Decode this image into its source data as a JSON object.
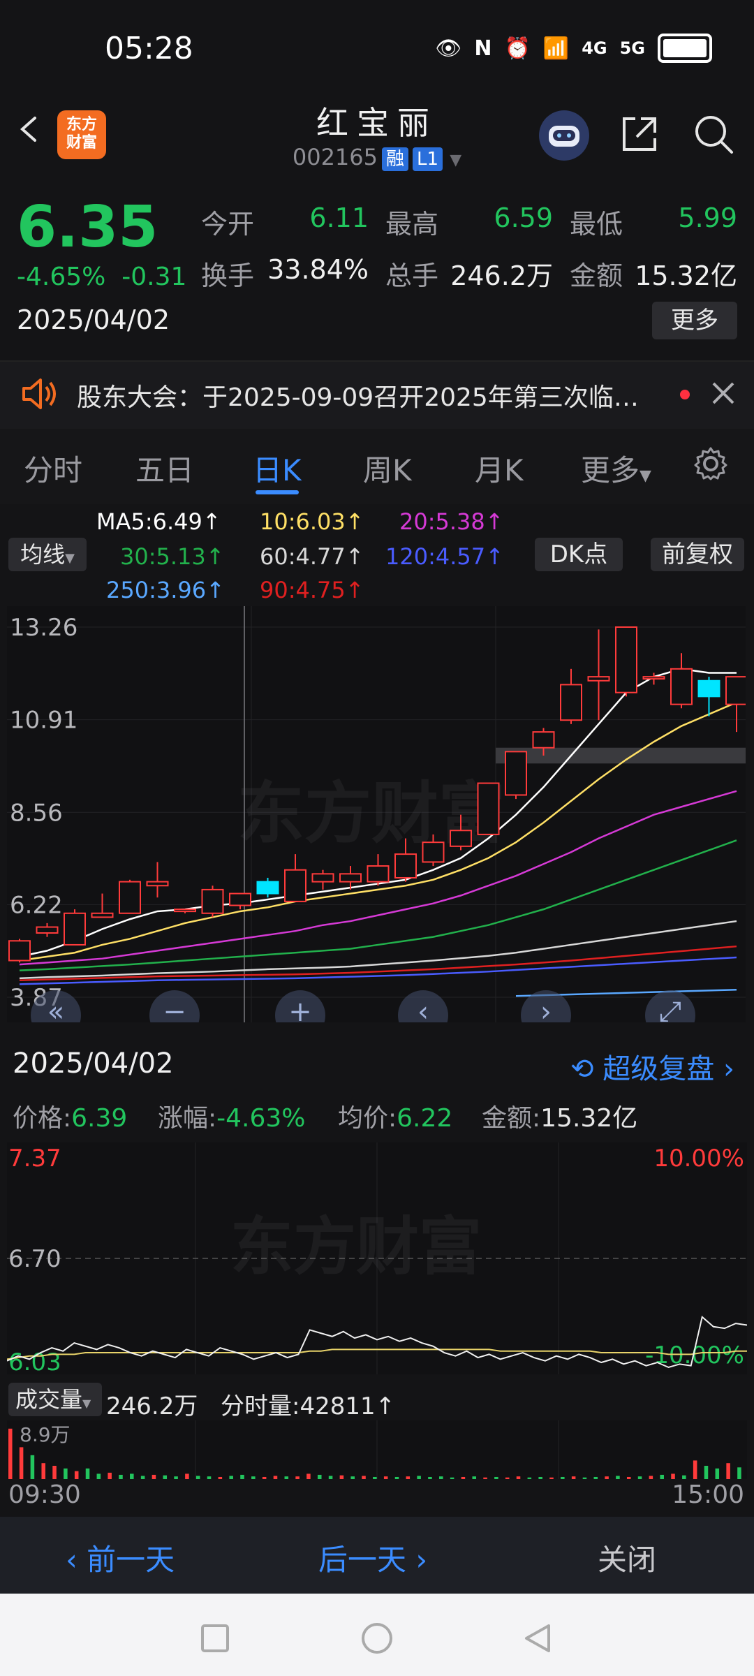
{
  "status_bar": {
    "time": "05:28",
    "network": "4G",
    "network2": "5G"
  },
  "header": {
    "logo_text_top": "东方",
    "logo_text_bottom": "财富",
    "stock_name": "红宝丽",
    "stock_code": "002165",
    "tag_margin": "融",
    "tag_level": "L1"
  },
  "quote": {
    "price": "6.35",
    "change_pct": "-4.65%",
    "change_amt": "-0.31",
    "date": "2025/04/02",
    "open_label": "今开",
    "open": "6.11",
    "high_label": "最高",
    "high": "6.59",
    "low_label": "最低",
    "low": "5.99",
    "turnover_label": "换手",
    "turnover": "33.84%",
    "volume_label": "总手",
    "volume": "246.2万",
    "amount_label": "金额",
    "amount": "15.32亿",
    "more_label": "更多"
  },
  "notice": {
    "text": "股东大会：于2025-09-09召开2025年第三次临…"
  },
  "tabs": [
    {
      "label": "分时"
    },
    {
      "label": "五日"
    },
    {
      "label": "日K"
    },
    {
      "label": "周K"
    },
    {
      "label": "月K"
    },
    {
      "label": "更多"
    }
  ],
  "ma_legend": {
    "dropdown": "均线",
    "ma5": "MA5:6.49↑",
    "ma10": "10:6.03↑",
    "ma20": "20:5.38↑",
    "ma30": "30:5.13↑",
    "ma60": "60:4.77↑",
    "ma120": "120:4.57↑",
    "ma250": "250:3.96↑",
    "ma90": "90:4.75↑",
    "dk_button": "DK点",
    "adjust_button": "前复权",
    "colors": {
      "ma5": "#ffffff",
      "ma10": "#ffe066",
      "ma20": "#d63ad6",
      "ma30": "#22b14c",
      "ma60": "#d8d8d8",
      "ma120": "#4a5cff",
      "ma250": "#5aa8ff",
      "ma90": "#e02020"
    }
  },
  "kchart": {
    "watermark": "东方财富",
    "axis_labels": [
      "13.26",
      "10.91",
      "8.56",
      "6.22",
      "3.87"
    ]
  },
  "chart_data": {
    "type": "candlestick",
    "ylim": [
      3.87,
      13.26
    ],
    "candles": [
      {
        "o": 4.8,
        "c": 5.3,
        "h": 5.35,
        "l": 4.75
      },
      {
        "o": 5.5,
        "c": 5.65,
        "h": 5.75,
        "l": 5.4
      },
      {
        "o": 5.2,
        "c": 6.0,
        "h": 6.1,
        "l": 5.2
      },
      {
        "o": 5.9,
        "c": 6.0,
        "h": 6.5,
        "l": 5.9
      },
      {
        "o": 6.0,
        "c": 6.8,
        "h": 6.85,
        "l": 6.0
      },
      {
        "o": 6.7,
        "c": 6.8,
        "h": 7.3,
        "l": 6.4
      },
      {
        "o": 6.1,
        "c": 6.1,
        "h": 6.1,
        "l": 6.0
      },
      {
        "o": 6.0,
        "c": 6.6,
        "h": 6.7,
        "l": 5.9
      },
      {
        "o": 6.2,
        "c": 6.5,
        "h": 6.5,
        "l": 6.1
      },
      {
        "o": 6.8,
        "c": 6.5,
        "h": 6.9,
        "l": 6.4
      },
      {
        "o": 6.3,
        "c": 7.1,
        "h": 7.5,
        "l": 6.3
      },
      {
        "o": 6.8,
        "c": 7.0,
        "h": 7.1,
        "l": 6.6
      },
      {
        "o": 6.8,
        "c": 7.0,
        "h": 7.2,
        "l": 6.6
      },
      {
        "o": 6.8,
        "c": 7.2,
        "h": 7.5,
        "l": 6.7
      },
      {
        "o": 6.9,
        "c": 7.5,
        "h": 7.9,
        "l": 6.8
      },
      {
        "o": 7.3,
        "c": 7.8,
        "h": 8.0,
        "l": 7.2
      },
      {
        "o": 7.7,
        "c": 8.1,
        "h": 8.5,
        "l": 7.6
      },
      {
        "o": 8.0,
        "c": 9.3,
        "h": 9.3,
        "l": 8.0
      },
      {
        "o": 9.0,
        "c": 10.1,
        "h": 10.1,
        "l": 8.9
      },
      {
        "o": 10.2,
        "c": 10.6,
        "h": 10.7,
        "l": 10.0
      },
      {
        "o": 10.9,
        "c": 11.8,
        "h": 12.2,
        "l": 10.8
      },
      {
        "o": 11.9,
        "c": 12.0,
        "h": 13.2,
        "l": 10.9
      },
      {
        "o": 11.6,
        "c": 13.26,
        "h": 13.26,
        "l": 11.5
      },
      {
        "o": 12.0,
        "c": 12.0,
        "h": 12.1,
        "l": 11.8
      },
      {
        "o": 11.3,
        "c": 12.2,
        "h": 12.6,
        "l": 11.2
      },
      {
        "o": 11.9,
        "c": 11.5,
        "h": 12.0,
        "l": 11.0
      },
      {
        "o": 11.3,
        "c": 12.0,
        "h": 12.0,
        "l": 10.6
      }
    ],
    "ma5": [
      4.9,
      5.05,
      5.3,
      5.6,
      5.85,
      6.05,
      6.1,
      6.2,
      6.25,
      6.35,
      6.45,
      6.55,
      6.65,
      6.75,
      6.85,
      7.1,
      7.4,
      7.9,
      8.5,
      9.2,
      10.0,
      10.8,
      11.6,
      12.0,
      12.2,
      12.1,
      12.1
    ],
    "ma10": [
      4.8,
      4.9,
      5.0,
      5.2,
      5.35,
      5.55,
      5.75,
      5.9,
      6.05,
      6.15,
      6.3,
      6.4,
      6.5,
      6.6,
      6.7,
      6.85,
      7.1,
      7.4,
      7.8,
      8.3,
      8.85,
      9.4,
      9.9,
      10.35,
      10.75,
      11.05,
      11.35
    ],
    "ma20": [
      4.7,
      4.75,
      4.8,
      4.85,
      4.95,
      5.05,
      5.15,
      5.25,
      5.35,
      5.45,
      5.55,
      5.7,
      5.8,
      5.95,
      6.1,
      6.25,
      6.45,
      6.7,
      6.95,
      7.25,
      7.55,
      7.9,
      8.2,
      8.5,
      8.7,
      8.9,
      9.1
    ],
    "ma30": [
      4.55,
      4.58,
      4.62,
      4.66,
      4.7,
      4.75,
      4.8,
      4.85,
      4.9,
      4.95,
      5.0,
      5.05,
      5.1,
      5.2,
      5.3,
      5.4,
      5.55,
      5.7,
      5.9,
      6.1,
      6.35,
      6.6,
      6.85,
      7.1,
      7.35,
      7.6,
      7.85
    ],
    "ma60": [
      4.35,
      4.38,
      4.4,
      4.42,
      4.45,
      4.48,
      4.5,
      4.52,
      4.55,
      4.58,
      4.6,
      4.62,
      4.65,
      4.7,
      4.75,
      4.8,
      4.86,
      4.92,
      5.0,
      5.1,
      5.2,
      5.3,
      5.4,
      5.5,
      5.6,
      5.7,
      5.8
    ],
    "ma90": [
      4.3,
      4.32,
      4.34,
      4.36,
      4.38,
      4.4,
      4.41,
      4.42,
      4.43,
      4.44,
      4.45,
      4.47,
      4.49,
      4.52,
      4.55,
      4.58,
      4.62,
      4.66,
      4.7,
      4.75,
      4.8,
      4.86,
      4.92,
      4.98,
      5.04,
      5.1,
      5.16
    ],
    "ma120": [
      4.2,
      4.22,
      4.24,
      4.26,
      4.28,
      4.3,
      4.31,
      4.32,
      4.33,
      4.34,
      4.35,
      4.37,
      4.39,
      4.41,
      4.43,
      4.46,
      4.49,
      4.52,
      4.56,
      4.6,
      4.64,
      4.68,
      4.72,
      4.76,
      4.8,
      4.84,
      4.88
    ],
    "ma250": [
      null,
      null,
      null,
      null,
      null,
      null,
      null,
      null,
      null,
      null,
      null,
      null,
      null,
      null,
      null,
      null,
      null,
      null,
      3.9,
      3.92,
      3.94,
      3.96,
      3.98,
      4.0,
      4.02,
      4.04,
      4.06
    ],
    "highlight_band": [
      9.8,
      10.2
    ]
  },
  "intraday_info": {
    "date": "2025/04/02",
    "super_replay": "超级复盘",
    "price_label": "价格:",
    "price": "6.39",
    "chg_label": "涨幅:",
    "chg": "-4.63%",
    "avg_label": "均价:",
    "avg": "6.22",
    "amt_label": "金额:",
    "amt": "15.32亿"
  },
  "minute_chart": {
    "y_top": "7.37",
    "y_mid": "6.70",
    "y_bot": "6.03",
    "pct_top": "10.00%",
    "pct_bot": "-10.00%",
    "watermark": "东方财富",
    "price_series": [
      6.07,
      6.1,
      6.08,
      6.12,
      6.15,
      6.13,
      6.18,
      6.16,
      6.14,
      6.17,
      6.15,
      6.12,
      6.1,
      6.13,
      6.11,
      6.09,
      6.14,
      6.12,
      6.1,
      6.15,
      6.13,
      6.11,
      6.08,
      6.1,
      6.12,
      6.09,
      6.11,
      6.26,
      6.24,
      6.22,
      6.25,
      6.21,
      6.23,
      6.2,
      6.22,
      6.19,
      6.21,
      6.18,
      6.16,
      6.12,
      6.1,
      6.13,
      6.09,
      6.11,
      6.08,
      6.1,
      6.12,
      6.09,
      6.07,
      6.1,
      6.08,
      6.11,
      6.09,
      6.06,
      6.08,
      6.05,
      6.07,
      6.04,
      6.06,
      6.03,
      6.05,
      6.04,
      6.34,
      6.28,
      6.27,
      6.3,
      6.29
    ],
    "avg_series": [
      6.08,
      6.09,
      6.1,
      6.1,
      6.11,
      6.11,
      6.11,
      6.12,
      6.12,
      6.12,
      6.12,
      6.12,
      6.12,
      6.12,
      6.12,
      6.12,
      6.12,
      6.12,
      6.12,
      6.12,
      6.12,
      6.12,
      6.12,
      6.12,
      6.12,
      6.12,
      6.12,
      6.13,
      6.13,
      6.14,
      6.14,
      6.14,
      6.14,
      6.14,
      6.14,
      6.14,
      6.14,
      6.14,
      6.14,
      6.14,
      6.14,
      6.14,
      6.14,
      6.14,
      6.13,
      6.13,
      6.13,
      6.13,
      6.13,
      6.13,
      6.13,
      6.13,
      6.13,
      6.12,
      6.12,
      6.12,
      6.12,
      6.12,
      6.12,
      6.11,
      6.11,
      6.11,
      6.12,
      6.12,
      6.12,
      6.13,
      6.13
    ]
  },
  "volume": {
    "dropdown": "成交量",
    "total": "246.2万",
    "minute_vol": "分时量:42811↑",
    "scale_label": "8.9万",
    "bars": [
      0.95,
      0.6,
      0.45,
      0.3,
      0.25,
      0.2,
      0.15,
      0.2,
      0.1,
      0.12,
      0.08,
      0.1,
      0.06,
      0.08,
      0.07,
      0.05,
      0.1,
      0.06,
      0.05,
      0.04,
      0.06,
      0.08,
      0.05,
      0.04,
      0.06,
      0.05,
      0.05,
      0.1,
      0.08,
      0.06,
      0.07,
      0.05,
      0.06,
      0.04,
      0.05,
      0.04,
      0.05,
      0.06,
      0.04,
      0.05,
      0.03,
      0.04,
      0.05,
      0.03,
      0.04,
      0.03,
      0.05,
      0.03,
      0.04,
      0.03,
      0.04,
      0.05,
      0.03,
      0.04,
      0.05,
      0.06,
      0.04,
      0.05,
      0.06,
      0.08,
      0.1,
      0.07,
      0.35,
      0.25,
      0.2,
      0.3,
      0.22
    ]
  },
  "time_axis": {
    "start": "09:30",
    "end": "15:00"
  },
  "bottom_nav": {
    "prev": "前一天",
    "next": "后一天",
    "close": "关闭"
  }
}
